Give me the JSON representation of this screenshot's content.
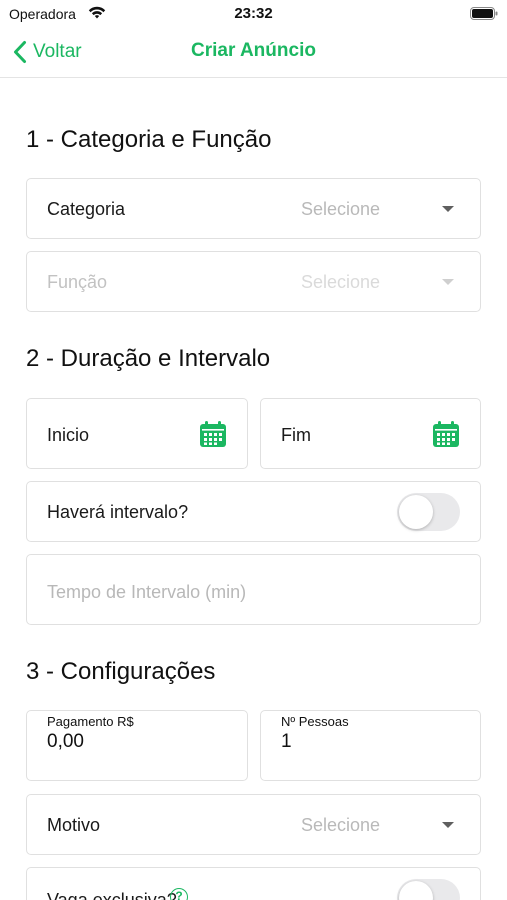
{
  "status_bar": {
    "carrier": "Operadora",
    "time": "23:32"
  },
  "nav": {
    "back_label": "Voltar",
    "title": "Criar Anúncio"
  },
  "section1": {
    "title": "1 - Categoria e Função",
    "categoria": {
      "label": "Categoria",
      "value": "Selecione"
    },
    "funcao": {
      "label": "Função",
      "value": "Selecione"
    }
  },
  "section2": {
    "title": "2 - Duração e Intervalo",
    "inicio_label": "Inicio",
    "fim_label": "Fim",
    "intervalo_label": "Haverá intervalo?",
    "intervalo_on": false,
    "tempo_placeholder": "Tempo de Intervalo (min)"
  },
  "section3": {
    "title": "3 - Configurações",
    "pagamento": {
      "label": "Pagamento R$",
      "value": "0,00"
    },
    "pessoas": {
      "label": "Nº Pessoas",
      "value": "1"
    },
    "motivo": {
      "label": "Motivo",
      "value": "Selecione"
    },
    "partial_label": "Vaga exclusiva?"
  },
  "colors": {
    "accent": "#1bb761",
    "border": "#e0e0e0",
    "placeholder": "#b9b9b9"
  },
  "icons": [
    "wifi-icon",
    "battery-icon",
    "chevron-left-icon",
    "calendar-icon",
    "caret-down-icon",
    "help-icon"
  ]
}
